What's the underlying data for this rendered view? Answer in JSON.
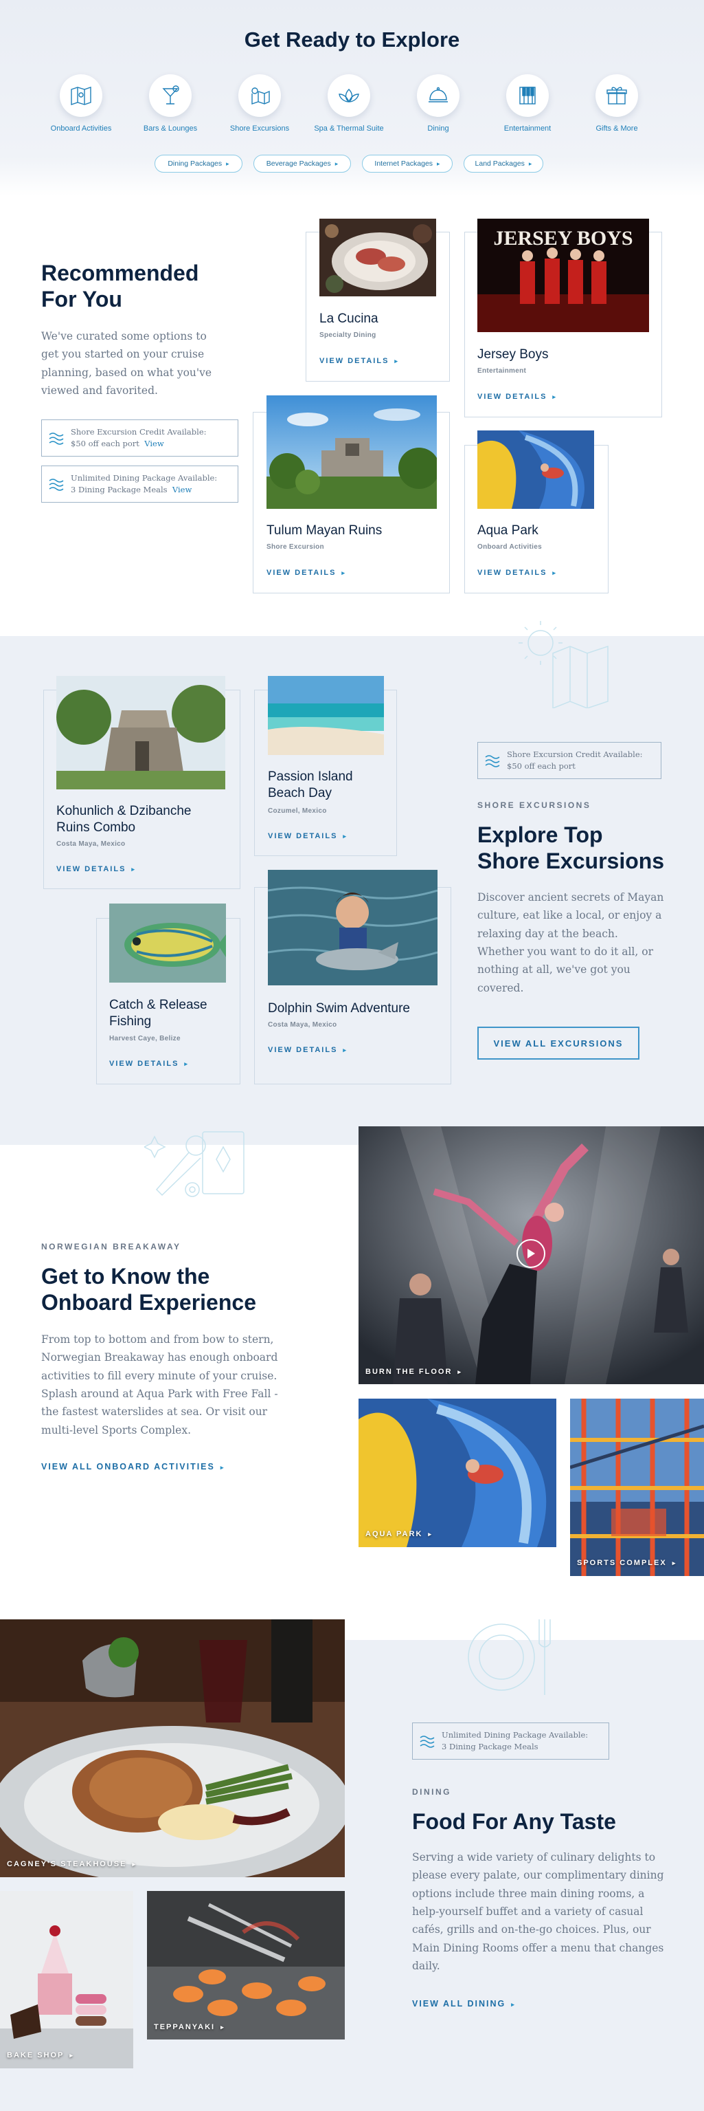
{
  "explore": {
    "title": "Get Ready to Explore",
    "categories": [
      {
        "label": "Onboard Activities",
        "icon": "map-icon"
      },
      {
        "label": "Bars & Lounges",
        "icon": "cocktail-icon"
      },
      {
        "label": "Shore Excursions",
        "icon": "island-map-icon"
      },
      {
        "label": "Spa & Thermal Suite",
        "icon": "lotus-icon"
      },
      {
        "label": "Dining",
        "icon": "cloche-icon"
      },
      {
        "label": "Entertainment",
        "icon": "piano-icon"
      },
      {
        "label": "Gifts & More",
        "icon": "gift-icon"
      }
    ],
    "packages": [
      "Dining Packages",
      "Beverage Packages",
      "Internet Packages",
      "Land Packages"
    ]
  },
  "recommended": {
    "title_line1": "Recommended",
    "title_line2": "For You",
    "description": "We've curated some options to get you started on your cruise planning, based on what you've viewed and favorited.",
    "credits": [
      {
        "line1": "Shore Excursion Credit Available:",
        "line2": "$50 off each port",
        "link": "View"
      },
      {
        "line1": "Unlimited Dining Package Available:",
        "line2": "3 Dining Package Meals",
        "link": "View"
      }
    ],
    "cards": [
      {
        "title": "La Cucina",
        "subtitle": "Specialty Dining",
        "link": "VIEW DETAILS"
      },
      {
        "title": "Jersey Boys",
        "subtitle": "Entertainment",
        "link": "VIEW DETAILS",
        "poster": "JERSEY BOYS"
      },
      {
        "title": "Tulum Mayan Ruins",
        "subtitle": "Shore Excursion",
        "link": "VIEW DETAILS"
      },
      {
        "title": "Aqua Park",
        "subtitle": "Onboard Activities",
        "link": "VIEW DETAILS"
      }
    ]
  },
  "shore": {
    "cards": [
      {
        "title_line1": "Kohunlich & Dzibanche",
        "title_line2": "Ruins Combo",
        "subtitle": "Costa Maya, Mexico",
        "link": "VIEW DETAILS"
      },
      {
        "title_line1": "Passion Island",
        "title_line2": "Beach Day",
        "subtitle": "Cozumel, Mexico",
        "link": "VIEW DETAILS"
      },
      {
        "title_line1": "Catch & Release",
        "title_line2": "Fishing",
        "subtitle": "Harvest Caye, Belize",
        "link": "VIEW DETAILS"
      },
      {
        "title_line1": "Dolphin Swim Adventure",
        "title_line2": "",
        "subtitle": "Costa Maya, Mexico",
        "link": "VIEW DETAILS"
      }
    ],
    "credit": {
      "line1": "Shore Excursion Credit Available:",
      "line2": "$50 off each port"
    },
    "eyebrow": "SHORE EXCURSIONS",
    "title_line1": "Explore Top",
    "title_line2": "Shore Excursions",
    "description": "Discover ancient secrets of Mayan culture, eat like a local, or enjoy a relaxing day at the beach. Whether you want to do it all, or nothing at all, we've got you covered.",
    "button": "VIEW ALL EXCURSIONS"
  },
  "onboard": {
    "eyebrow": "NORWEGIAN BREAKAWAY",
    "title_line1": "Get to Know the",
    "title_line2": "Onboard Experience",
    "description": "From top to bottom and from bow to stern, Norwegian Breakaway has enough onboard activities to fill every minute of your cruise. Splash around at Aqua Park with Free Fall - the fastest waterslides at sea. Or visit our multi-level Sports Complex.",
    "link": "VIEW ALL ONBOARD ACTIVITIES",
    "tiles": [
      "BURN THE FLOOR",
      "AQUA PARK",
      "SPORTS COMPLEX"
    ]
  },
  "dining": {
    "tiles": [
      "CAGNEY'S STEAKHOUSE",
      "BAKE SHOP",
      "TEPPANYAKI"
    ],
    "credit": {
      "line1": "Unlimited Dining Package Available:",
      "line2": "3 Dining Package Meals"
    },
    "eyebrow": "DINING",
    "title": "Food For Any Taste",
    "description": "Serving a wide variety of culinary delights to please every palate, our complimentary dining options include three main dining rooms, a help-yourself buffet and a variety of casual cafés, grills and on-the-go choices. Plus, our Main Dining Rooms offer a menu that changes daily.",
    "link": "VIEW ALL DINING"
  },
  "colors": {
    "navy": "#0d2340",
    "accent": "#1f7fb8",
    "section_bg": "#ecf0f6"
  }
}
